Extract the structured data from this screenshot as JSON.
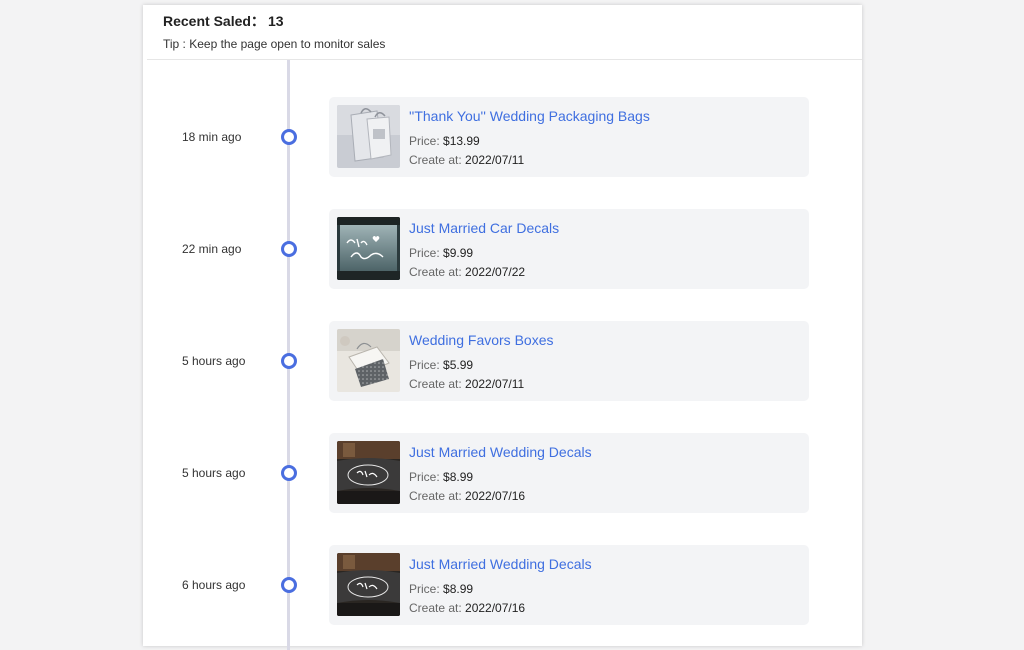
{
  "header": {
    "title_label": "Recent Saled：",
    "count": "13",
    "tip": "Tip : Keep the page open to monitor sales"
  },
  "labels": {
    "price": "Price: ",
    "created": "Create at: "
  },
  "colors": {
    "accent": "#4a6ee0",
    "link": "#3f6fe0",
    "card_bg": "#f3f4f6",
    "timeline": "#d9d9e6"
  },
  "sales": [
    {
      "time": "18 min ago",
      "title": "''Thank You'' Wedding Packaging Bags",
      "price": "$13.99",
      "created": "2022/07/11",
      "image": "packaging-bag-thumbnail"
    },
    {
      "time": "22 min ago",
      "title": "Just Married Car Decals",
      "price": "$9.99",
      "created": "2022/07/22",
      "image": "car-decal-thumbnail"
    },
    {
      "time": "5 hours ago",
      "title": "Wedding Favors Boxes",
      "price": "$5.99",
      "created": "2022/07/11",
      "image": "favor-box-thumbnail"
    },
    {
      "time": "5 hours ago",
      "title": "Just Married Wedding Decals",
      "price": "$8.99",
      "created": "2022/07/16",
      "image": "wedding-decal-thumbnail"
    },
    {
      "time": "6 hours ago",
      "title": "Just Married Wedding Decals",
      "price": "$8.99",
      "created": "2022/07/16",
      "image": "wedding-decal-thumbnail"
    }
  ]
}
